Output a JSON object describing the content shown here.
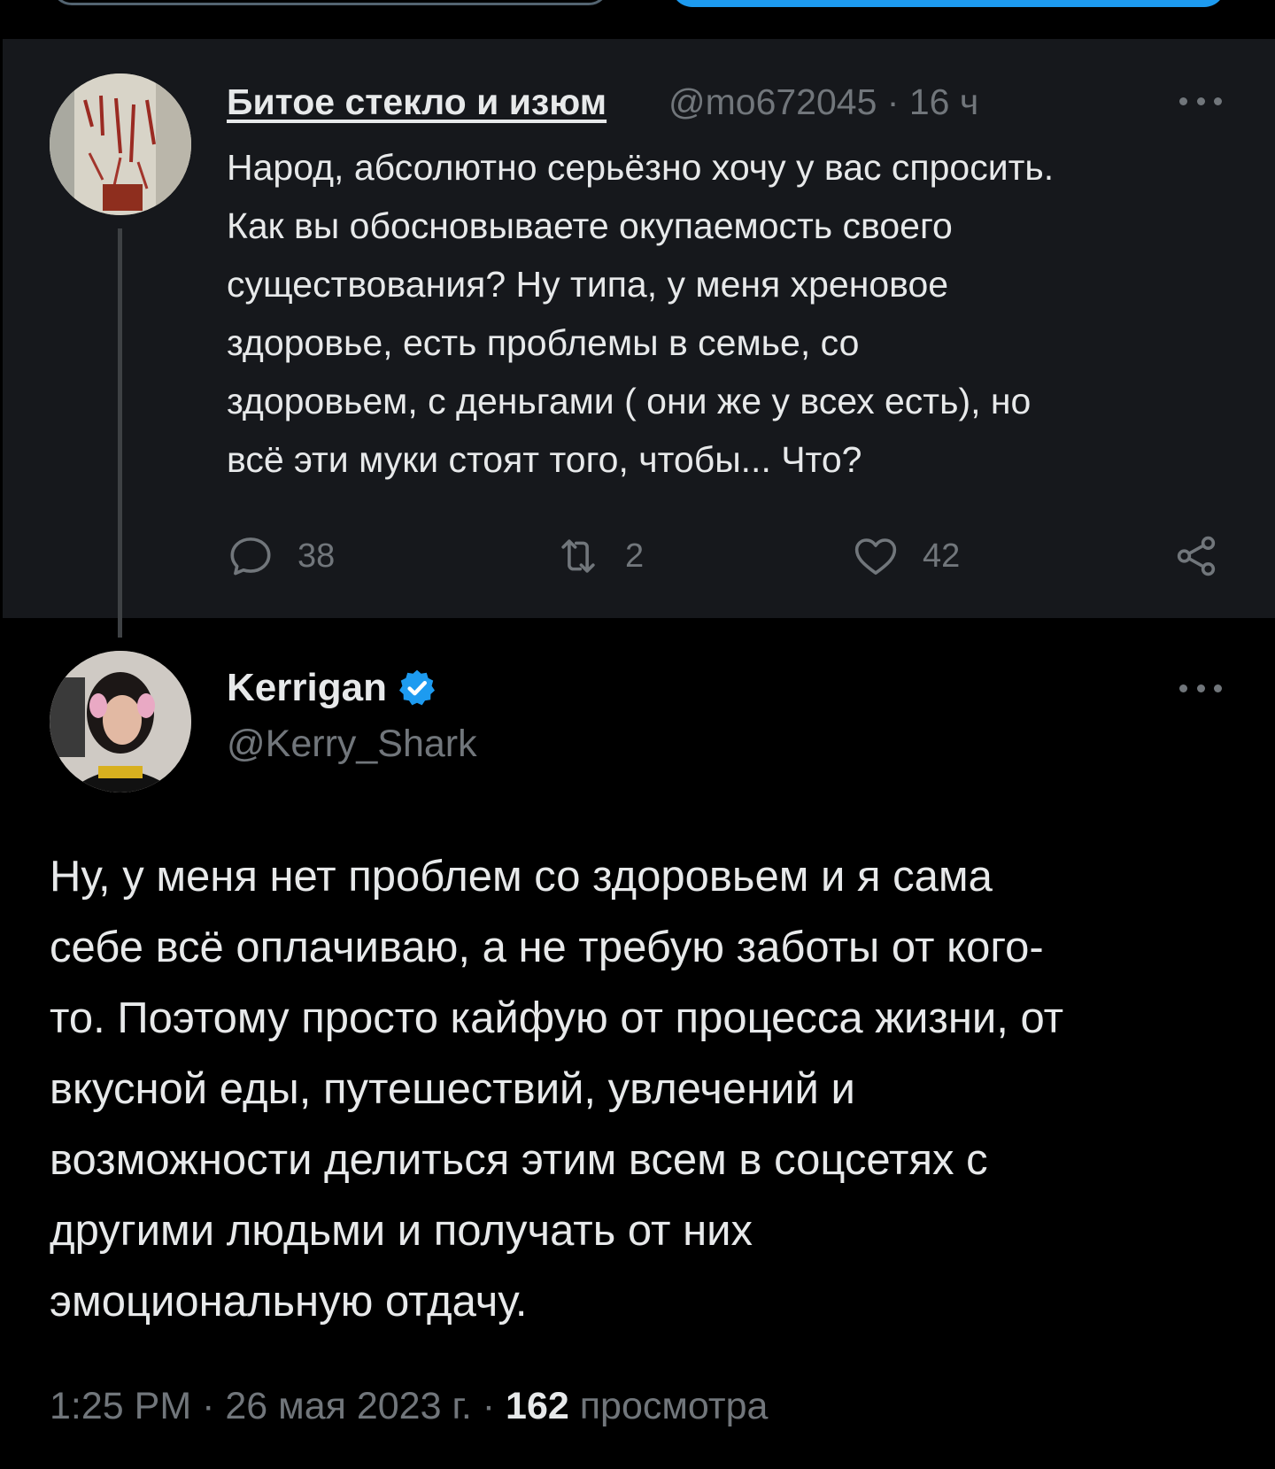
{
  "parent_tweet": {
    "author_name": "Битое стекло и изюм",
    "author_handle": "@mo672045",
    "time": "· 16 ч",
    "text": "Народ, абсолютно серьёзно хочу у вас спросить.\nКак вы обосновываете окупаемость своего\nсуществования? Ну типа, у меня хреновое\nздоровье, есть проблемы в семье, со\nздоровьем, с деньгами ( они же у всех есть), но\nвсё эти муки стоят того, чтобы... Что?",
    "reply_count": "38",
    "retweet_count": "2",
    "like_count": "42",
    "icons": {
      "more": "more-horizontal-icon",
      "reply": "reply-icon",
      "retweet": "retweet-icon",
      "like": "heart-icon",
      "share": "share-icon"
    }
  },
  "main_tweet": {
    "author_name": "Kerrigan",
    "author_handle": "@Kerry_Shark",
    "text": "Ну, у меня нет проблем со здоровьем и я сама\nсебе всё оплачиваю, а не требую заботы от кого-\nто. Поэтому просто кайфую от процесса жизни, от\nвкусной еды, путешествий, увлечений и\nвозможности делиться этим всем в соцсетях с\nдругими людьми и получать от них\nэмоциональную отдачу.",
    "timestamp": "1:25 PM · 26 мая 2023 г. · ",
    "views_count": "162",
    "views_label": " просмотра"
  },
  "colors": {
    "background": "#000000",
    "card_background": "#16181c",
    "text_primary": "#e7e9ea",
    "text_secondary": "#71767b",
    "accent": "#1d9bf0",
    "thread_line": "#3e4144"
  }
}
